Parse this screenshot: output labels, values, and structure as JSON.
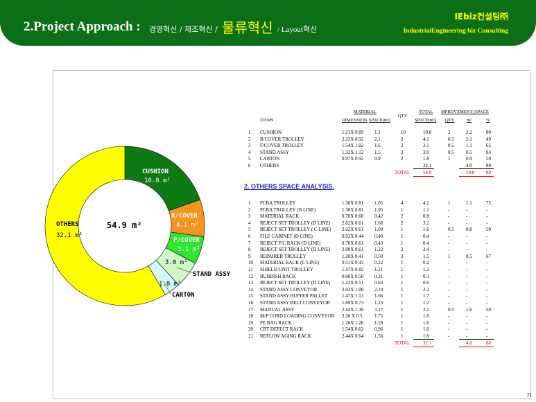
{
  "header": {
    "title": "2.Project Approach :",
    "sub1": "경영혁신 / 제조혁신 /",
    "highlight": "물류혁신",
    "sub2": "/ Layout혁신",
    "brand": "IEbiz컨설팅㈜",
    "tagline": "IndustrialEngineering biz Consulting"
  },
  "colors": {
    "header_green": "#0c6e17",
    "highlight_yellow": "#ffff00",
    "total_red": "#d40000",
    "section_blue": "#1b22c2"
  },
  "chart_data": {
    "type": "pie",
    "center_label": "54.9 m²",
    "slices": [
      {
        "name": "CUSHION",
        "value": 10.8,
        "value_label": "10.8 m²",
        "color": "#0f7a13"
      },
      {
        "name": "R/COVER",
        "value": 4.1,
        "value_label": "4.1 m²",
        "color": "#f7941d"
      },
      {
        "name": "F/COVER",
        "value": 3.1,
        "value_label": "3.1 m²",
        "color": "#2ee62e"
      },
      {
        "name": "STAND ASSY",
        "value": 3.0,
        "value_label": "3.0 m²",
        "color": "#d0f7c7"
      },
      {
        "name": "CARTON",
        "value": 1.8,
        "value_label": "1.8 m²",
        "color": "#d2f8f8"
      },
      {
        "name": "OTHERS",
        "value": 32.1,
        "value_label": "32.1 m²",
        "color": "#ffff00"
      }
    ]
  },
  "table1": {
    "group_header_material": "MATERIAL",
    "group_header_total": "TOTAL",
    "group_header_improvement": "MPROVEMENT (SPACE",
    "col_items": "ITEMS",
    "col_dimension": "DIMENSION",
    "col_space": "SPACE(m²)",
    "col_qty": "QTY",
    "col_total_space": "SPACE(m²)",
    "col_imp_qty": "QTY",
    "col_imp_m2": "m²",
    "col_imp_pct": "%",
    "rows": [
      {
        "no": "1",
        "item": "CUSHION",
        "dim": "1.21X 0.89",
        "space": "1.1",
        "qty": "10",
        "total": "10.8",
        "iq": "2",
        "im": "2.2",
        "ip": "80"
      },
      {
        "no": "2",
        "item": "R/COVER TROLLEY",
        "dim": "2.23X 0.92",
        "space": "2.1",
        "qty": "2",
        "total": "4.1",
        "iq": "0.5",
        "im": "2.1",
        "ip": "49"
      },
      {
        "no": "3",
        "item": "F/COVER TROLLEY",
        "dim": "1.54X 1.02",
        "space": "1.6",
        "qty": "2",
        "total": "3.1",
        "iq": "0.5",
        "im": "1.1",
        "ip": "65"
      },
      {
        "no": "4",
        "item": "STAND ASSY",
        "dim": "1.32X 1.12",
        "space": "1.5",
        "qty": "2",
        "total": "3.0",
        "iq": "0.5",
        "im": "0.5",
        "ip": "83"
      },
      {
        "no": "5",
        "item": "CARTON",
        "dim": "0.97X 0.92",
        "space": "0.9",
        "qty": "2",
        "total": "1.8",
        "iq": "1",
        "im": "0.9",
        "ip": "50"
      },
      {
        "no": "6",
        "item": "OTHERS",
        "dim": "",
        "space": "",
        "qty": "",
        "total": "32.1",
        "iq": "",
        "im": "4.0",
        "ip": "88"
      }
    ],
    "total_label": "TOTAL",
    "total_space": "54.9",
    "total_imp_m2": "10.8",
    "total_imp_pct": "80"
  },
  "section2_title": "2.  OTHERS SPACE ANALYSIS.",
  "table2": {
    "rows": [
      {
        "no": "1",
        "item": "PCBA TROLLEY",
        "dim": "1.30X 0.81",
        "space": "1.05",
        "qty": "4",
        "total": "4.2",
        "iq": "1",
        "im": "1.1",
        "ip": "75"
      },
      {
        "no": "2",
        "item": "PCBA TROLLEY (D LINE)",
        "dim": "1.30X 0.81",
        "space": "1.05",
        "qty": "1",
        "total": "1.1",
        "iq": "-",
        "im": "-",
        "ip": "-"
      },
      {
        "no": "3",
        "item": "MATERIAL RACK",
        "dim": "0.70X 0.60",
        "space": "0.42",
        "qty": "2",
        "total": "0.8",
        "iq": "-",
        "im": "-",
        "ip": "-"
      },
      {
        "no": "4",
        "item": "REJECT SET TROLLEY (D LINE)",
        "dim": "2.62X 0.61",
        "space": "1.60",
        "qty": "2",
        "total": "3.2",
        "iq": "-",
        "im": "-",
        "ip": "-"
      },
      {
        "no": "5",
        "item": "REJECT SET TROLLEY ( C LINE)",
        "dim": "2.62X 0.61",
        "space": "1.60",
        "qty": "1",
        "total": "1.6",
        "iq": "0.5",
        "im": "0.8",
        "ip": "50"
      },
      {
        "no": "6",
        "item": "FILE CABINET (D LINE)",
        "dim": "0.92X 0.44",
        "space": "0.40",
        "qty": "1",
        "total": "0.4",
        "iq": "-",
        "im": "-",
        "ip": "-"
      },
      {
        "no": "7",
        "item": "REJECT F/C RACK (D LINE)",
        "dim": "0.70X 0.61",
        "space": "0.43",
        "qty": "1",
        "total": "0.4",
        "iq": "-",
        "im": "-",
        "ip": "-"
      },
      {
        "no": "8",
        "item": "REJECT SET TROLLEY (D LINE)",
        "dim": "2.00X 0.61",
        "space": "1.22",
        "qty": "2",
        "total": "2.4",
        "iq": "-",
        "im": "-",
        "ip": "-"
      },
      {
        "no": "9",
        "item": "REPAIRER TROLLEY",
        "dim": "1.20X 0.41",
        "space": "0.50",
        "qty": "3",
        "total": "1.5",
        "iq": "1",
        "im": "0.5",
        "ip": "67"
      },
      {
        "no": "10",
        "item": "MATERIAL RACK (C LINE)",
        "dim": "0.51X 0.43",
        "space": "0.22",
        "qty": "1",
        "total": "0.2",
        "iq": "-",
        "im": "-",
        "ip": "-"
      },
      {
        "no": "11",
        "item": "SHIELD UNIT TROLLEY",
        "dim": "1.47X 0.82",
        "space": "1.21",
        "qty": "1",
        "total": "1.2",
        "iq": "-",
        "im": "-",
        "ip": "-"
      },
      {
        "no": "12",
        "item": "RUBBISH RACK",
        "dim": "0.60X 0.50",
        "space": "0.31",
        "qty": "1",
        "total": "0.3",
        "iq": "-",
        "im": "-",
        "ip": "-"
      },
      {
        "no": "13",
        "item": "REJECT SET TROLLEY (D LINE)",
        "dim": "1.23X 0.51",
        "space": "0.63",
        "qty": "1",
        "total": "0.6",
        "iq": "-",
        "im": "-",
        "ip": "-"
      },
      {
        "no": "14",
        "item": "STAND ASSY CONVEYOR",
        "dim": "2.03X 1.08",
        "space": "2.19",
        "qty": "1",
        "total": "2.2",
        "iq": "-",
        "im": "-",
        "ip": "-"
      },
      {
        "no": "15",
        "item": "STAND ASSY BUFFER PALLET",
        "dim": "1.47X 1.13",
        "space": "1.66",
        "qty": "1",
        "total": "1.7",
        "iq": "-",
        "im": "-",
        "ip": "-"
      },
      {
        "no": "16",
        "item": "STAND ASSY BELT CONVEYOR",
        "dim": "1.69X 0.73",
        "space": "1.23",
        "qty": "1",
        "total": "1.2",
        "iq": "-",
        "im": "-",
        "ip": "-"
      },
      {
        "no": "17",
        "item": "MANUAL ASSY",
        "dim": "2.44X 1.30",
        "space": "3.17",
        "qty": "1",
        "total": "3.2",
        "iq": "0.5",
        "im": "1.6",
        "ip": "50"
      },
      {
        "no": "18",
        "item": "M/P CORD LOADING CONVEYOR",
        "dim": "3.50 X 0.5",
        "space": "1.75",
        "qty": "1",
        "total": "1.8",
        "iq": "-",
        "im": "-",
        "ip": "-"
      },
      {
        "no": "19",
        "item": "PE BAG RACK",
        "dim": "1.26X 1.26",
        "space": "1.59",
        "qty": "1",
        "total": "1.6",
        "iq": "-",
        "im": "-",
        "ip": "-"
      },
      {
        "no": "20",
        "item": "CRT DEFECT RACK",
        "dim": "1.54X 0.62",
        "space": "0.96",
        "qty": "1",
        "total": "1.0",
        "iq": "-",
        "im": "-",
        "ip": "-"
      },
      {
        "no": "21",
        "item": "REFLOW AGING RACK",
        "dim": "2.44X 0.64",
        "space": "1.56",
        "qty": "1",
        "total": "1.6",
        "iq": "-",
        "im": "-",
        "ip": "-"
      }
    ],
    "total_label": "TOTAL",
    "total_space": "32.1",
    "total_imp_m2": "4.0",
    "total_imp_pct": "88"
  },
  "page_number": "21"
}
